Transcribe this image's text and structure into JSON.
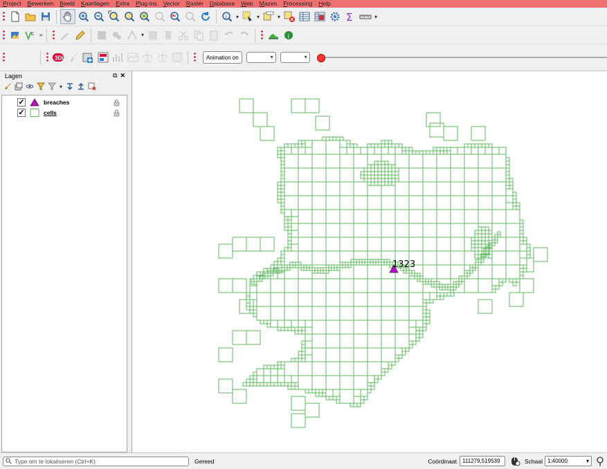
{
  "menu": [
    "Project",
    "Bewerken",
    "Beeld",
    "Kaartlagen",
    "Extra",
    "Plug-ins",
    "Vector",
    "Raster",
    "Database",
    "Web",
    "Mazen",
    "Processing",
    "Help"
  ],
  "toolbar3": {
    "animation_label": "Animation on"
  },
  "layers_panel": {
    "title": "Lagen",
    "layers": [
      {
        "name": "breaches",
        "checked": "✓",
        "symbol": "triangle",
        "color": "#c000d0"
      },
      {
        "name": "cells",
        "checked": "✓",
        "symbol": "square",
        "color": "#5cb85c"
      }
    ]
  },
  "map": {
    "cell_color": "#5cb85c",
    "breach_color": "#c000d0",
    "breach_label": "1323"
  },
  "status": {
    "locator_placeholder": "Type om te lokaliseren (Ctrl+K)",
    "status_text": "Gereed",
    "coord_label": "Coördinaat",
    "coord_value": "111279,519539",
    "scale_label": "Schaal",
    "scale_value": "1:40000"
  }
}
